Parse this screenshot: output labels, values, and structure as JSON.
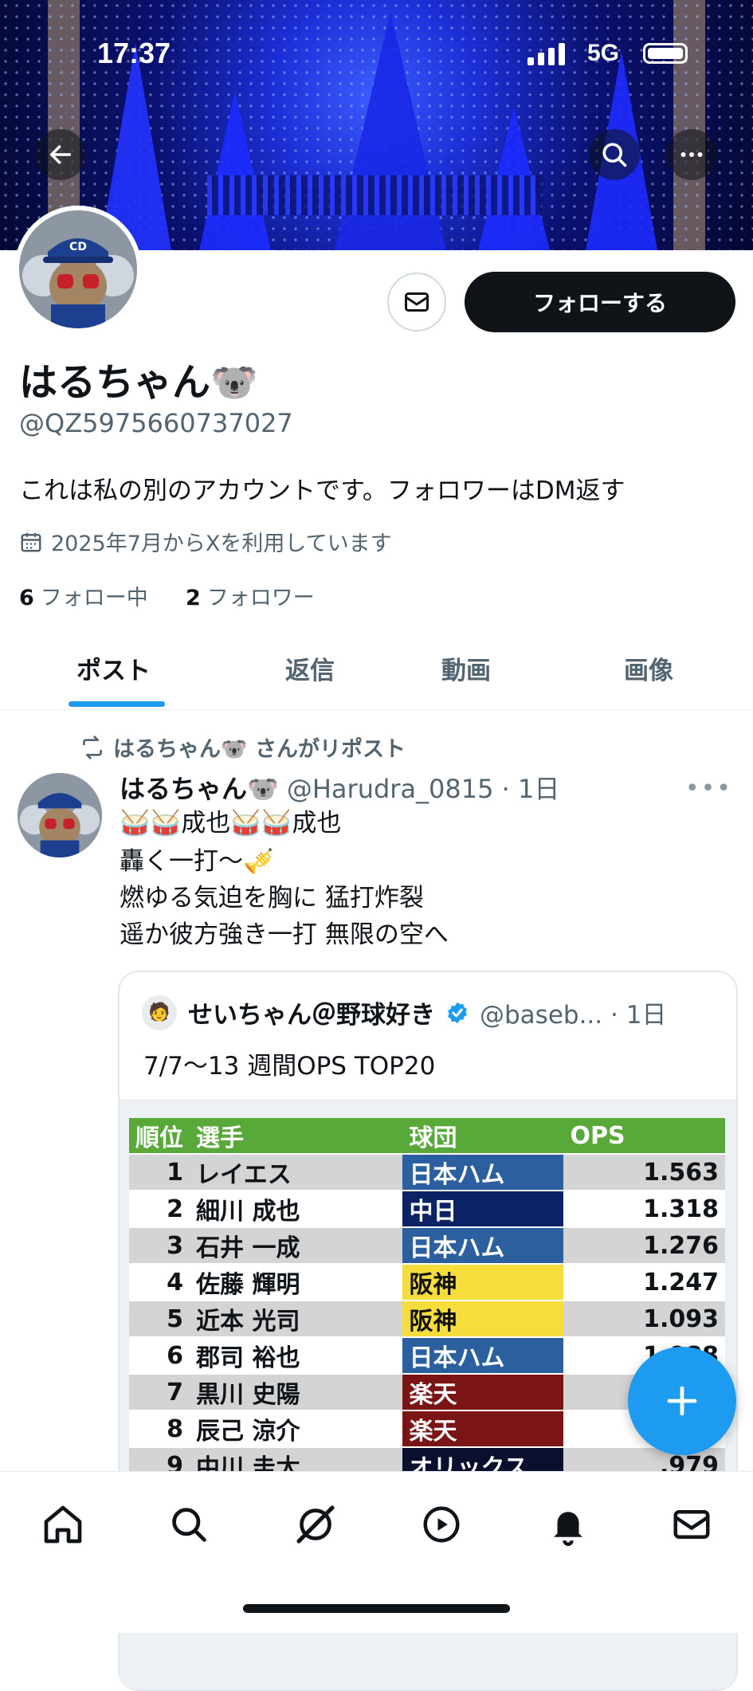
{
  "status_bar": {
    "time": "17:37",
    "network": "5G"
  },
  "profile": {
    "name": "はるちゃん🐨",
    "handle": "@QZ5975660737027",
    "bio": "これは私の別のアカウントです。フォロワーはDM返す",
    "joined": "2025年7月からXを利用しています",
    "following_count": "6",
    "following_label": "フォロー中",
    "followers_count": "2",
    "followers_label": "フォロワー",
    "follow_button": "フォローする"
  },
  "tabs": [
    {
      "label": "ポスト",
      "active": true
    },
    {
      "label": "返信",
      "active": false
    },
    {
      "label": "動画",
      "active": false
    },
    {
      "label": "画像",
      "active": false
    }
  ],
  "post": {
    "repost_label": "はるちゃん🐨 さんがリポスト",
    "author_name": "はるちゃん🐨",
    "author_meta": "@Harudra_0815 · 1日",
    "lines": [
      "🥁🥁成也🥁🥁成也",
      "轟く一打〜🎺",
      "燃ゆる気迫を胸に 猛打炸裂",
      "遥か彼方強き一打 無限の空へ"
    ],
    "quote": {
      "avatar": "🧑",
      "name": "せいちゃん＠野球好き",
      "meta": "@baseb... · 1日",
      "text": "7/7〜13 週間OPS TOP20",
      "table": {
        "headers": [
          "順位",
          "選手",
          "球団",
          "OPS"
        ],
        "rows": [
          {
            "rank": "1",
            "player": "レイエス",
            "team": "日本ハム",
            "ops": "1.563",
            "team_bg": "#2c5fa0",
            "team_fg": "#ffffff"
          },
          {
            "rank": "2",
            "player": "細川 成也",
            "team": "中日",
            "ops": "1.318",
            "team_bg": "#0c2366",
            "team_fg": "#ffffff"
          },
          {
            "rank": "3",
            "player": "石井 一成",
            "team": "日本ハム",
            "ops": "1.276",
            "team_bg": "#2c5fa0",
            "team_fg": "#ffffff"
          },
          {
            "rank": "4",
            "player": "佐藤 輝明",
            "team": "阪神",
            "ops": "1.247",
            "team_bg": "#f5dd3b",
            "team_fg": "#111111"
          },
          {
            "rank": "5",
            "player": "近本 光司",
            "team": "阪神",
            "ops": "1.093",
            "team_bg": "#f5dd3b",
            "team_fg": "#111111"
          },
          {
            "rank": "6",
            "player": "郡司 裕也",
            "team": "日本ハム",
            "ops": "1.088",
            "team_bg": "#2c5fa0",
            "team_fg": "#ffffff"
          },
          {
            "rank": "7",
            "player": "黒川 史陽",
            "team": "楽天",
            "ops": "",
            "team_bg": "#7a1415",
            "team_fg": "#ffffff"
          },
          {
            "rank": "8",
            "player": "辰己 涼介",
            "team": "楽天",
            "ops": "",
            "team_bg": "#7a1415",
            "team_fg": "#ffffff"
          },
          {
            "rank": "9",
            "player": "中川 圭太",
            "team": "オリックス",
            "ops": ".979",
            "team_bg": "#0a0f2e",
            "team_fg": "#ffffff"
          }
        ]
      }
    }
  },
  "colors": {
    "accent": "#1d9bf0",
    "text": "#0f1419",
    "muted": "#536471"
  },
  "bottom_nav": [
    "home-icon",
    "search-icon",
    "grok-icon",
    "video-icon",
    "notifications-icon",
    "messages-icon"
  ]
}
